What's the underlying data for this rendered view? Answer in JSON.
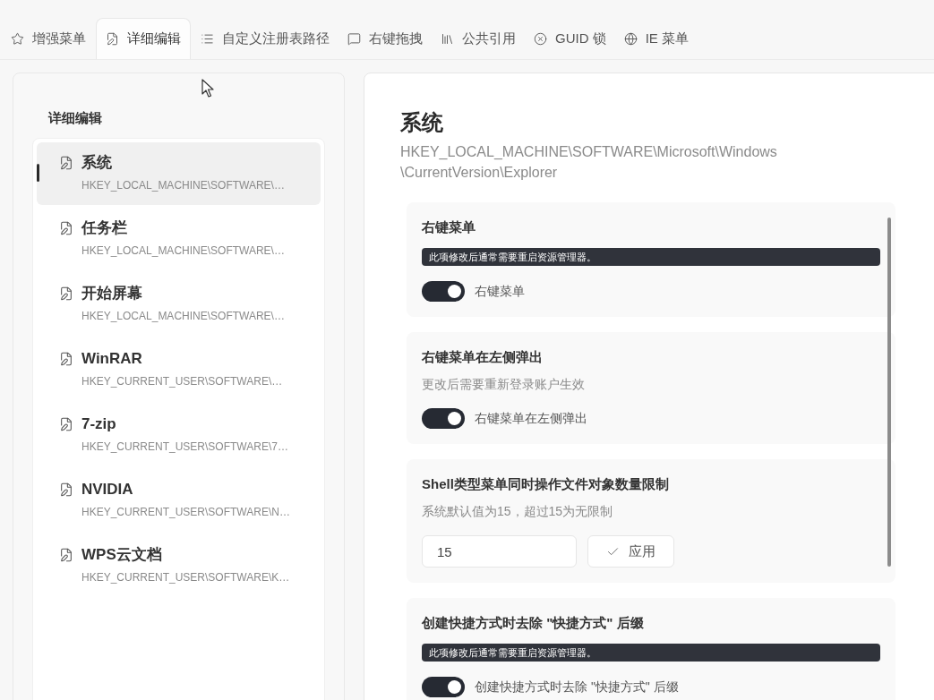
{
  "tabs": [
    {
      "label": "增强菜单",
      "selected": false
    },
    {
      "label": "详细编辑",
      "selected": true
    },
    {
      "label": "自定义注册表路径",
      "selected": false
    },
    {
      "label": "右键拖拽",
      "selected": false
    },
    {
      "label": "公共引用",
      "selected": false
    },
    {
      "label": "GUID 锁",
      "selected": false
    },
    {
      "label": "IE 菜单",
      "selected": false
    }
  ],
  "sidebar": {
    "title": "详细编辑",
    "items": [
      {
        "title": "系统",
        "path": "HKEY_LOCAL_MACHINE\\SOFTWARE\\…",
        "selected": true
      },
      {
        "title": "任务栏",
        "path": "HKEY_LOCAL_MACHINE\\SOFTWARE\\…",
        "selected": false
      },
      {
        "title": "开始屏幕",
        "path": "HKEY_LOCAL_MACHINE\\SOFTWARE\\…",
        "selected": false
      },
      {
        "title": "WinRAR",
        "path": "HKEY_CURRENT_USER\\SOFTWARE\\…",
        "selected": false
      },
      {
        "title": "7-zip",
        "path": "HKEY_CURRENT_USER\\SOFTWARE\\7…",
        "selected": false
      },
      {
        "title": "NVIDIA",
        "path": "HKEY_CURRENT_USER\\SOFTWARE\\N…",
        "selected": false
      },
      {
        "title": "WPS云文档",
        "path": "HKEY_CURRENT_USER\\SOFTWARE\\K…",
        "selected": false
      }
    ]
  },
  "detail": {
    "title": "系统",
    "path_lines": [
      "HKEY_LOCAL_MACHINE\\SOFTWARE\\Microsoft\\Windows",
      "\\CurrentVersion\\Explorer"
    ],
    "settings": [
      {
        "kind": "toggle",
        "title": "右键菜单",
        "notice": "此项修改后通常需要重启资源管理器。",
        "toggle": {
          "label": "右键菜单",
          "on": true
        }
      },
      {
        "kind": "toggle",
        "title": "右键菜单在左侧弹出",
        "description": "更改后需要重新登录账户生效",
        "toggle": {
          "label": "右键菜单在左侧弹出",
          "on": true
        }
      },
      {
        "kind": "number",
        "title": "Shell类型菜单同时操作文件对象数量限制",
        "description": "系统默认值为15，超过15为无限制",
        "input": {
          "value": "15"
        },
        "button": "应用"
      },
      {
        "kind": "toggle",
        "title": "创建快捷方式时去除 \"快捷方式\" 后缀",
        "notice": "此项修改后通常需要重启资源管理器。",
        "toggle": {
          "label": "创建快捷方式时去除 \"快捷方式\" 后缀",
          "on": true
        }
      }
    ]
  }
}
